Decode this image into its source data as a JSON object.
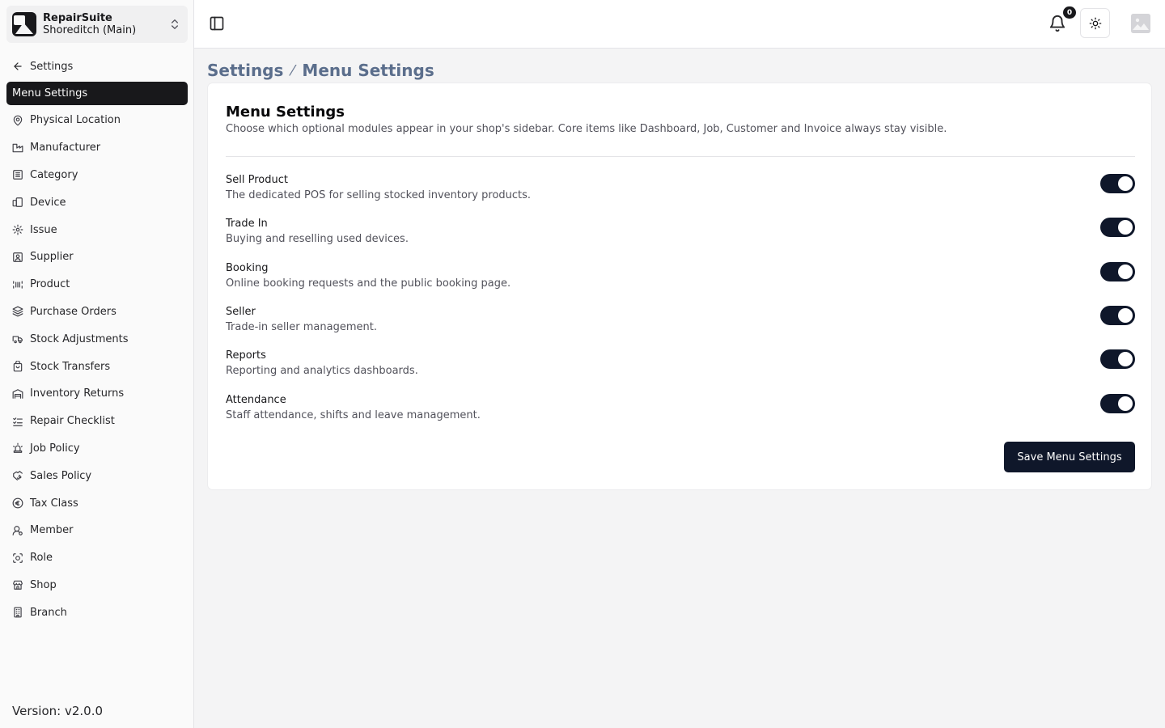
{
  "shop": {
    "name": "RepairSuite",
    "branch": "Shoreditch (Main)"
  },
  "sidebar": {
    "back_label": "Settings",
    "active_label": "Menu Settings",
    "items": [
      {
        "label": "Physical Location",
        "icon": "map-pin-icon"
      },
      {
        "label": "Manufacturer",
        "icon": "factory-icon"
      },
      {
        "label": "Category",
        "icon": "list-icon"
      },
      {
        "label": "Device",
        "icon": "device-icon"
      },
      {
        "label": "Issue",
        "icon": "gear-icon"
      },
      {
        "label": "Supplier",
        "icon": "contact-icon"
      },
      {
        "label": "Product",
        "icon": "barcode-icon"
      },
      {
        "label": "Purchase Orders",
        "icon": "layers-icon"
      },
      {
        "label": "Stock Adjustments",
        "icon": "truck-icon"
      },
      {
        "label": "Stock Transfers",
        "icon": "bag-icon"
      },
      {
        "label": "Inventory Returns",
        "icon": "warehouse-icon"
      },
      {
        "label": "Repair Checklist",
        "icon": "checklist-icon"
      },
      {
        "label": "Job Policy",
        "icon": "siren-icon"
      },
      {
        "label": "Sales Policy",
        "icon": "handshake-icon"
      },
      {
        "label": "Tax Class",
        "icon": "euro-icon"
      },
      {
        "label": "Member",
        "icon": "user-icon"
      },
      {
        "label": "Role",
        "icon": "scan-face-icon"
      },
      {
        "label": "Shop",
        "icon": "store-icon"
      },
      {
        "label": "Branch",
        "icon": "building-icon"
      }
    ],
    "version": "Version: v2.0.0"
  },
  "header": {
    "notification_count": "0"
  },
  "breadcrumb": {
    "parent": "Settings",
    "current": "Menu Settings"
  },
  "card": {
    "title": "Menu Settings",
    "description": "Choose which optional modules appear in your shop's sidebar. Core items like Dashboard, Job, Customer and Invoice always stay visible.",
    "options": [
      {
        "label": "Sell Product",
        "description": "The dedicated POS for selling stocked inventory products.",
        "enabled": true
      },
      {
        "label": "Trade In",
        "description": "Buying and reselling used devices.",
        "enabled": true
      },
      {
        "label": "Booking",
        "description": "Online booking requests and the public booking page.",
        "enabled": true
      },
      {
        "label": "Seller",
        "description": "Trade-in seller management.",
        "enabled": true
      },
      {
        "label": "Reports",
        "description": "Reporting and analytics dashboards.",
        "enabled": true
      },
      {
        "label": "Attendance",
        "description": "Staff attendance, shifts and leave management.",
        "enabled": true
      }
    ],
    "save_label": "Save Menu Settings"
  },
  "colors": {
    "primary": "#0f172a",
    "breadcrumb": "#5b6e8c",
    "sidebar_active": "#18181b"
  }
}
